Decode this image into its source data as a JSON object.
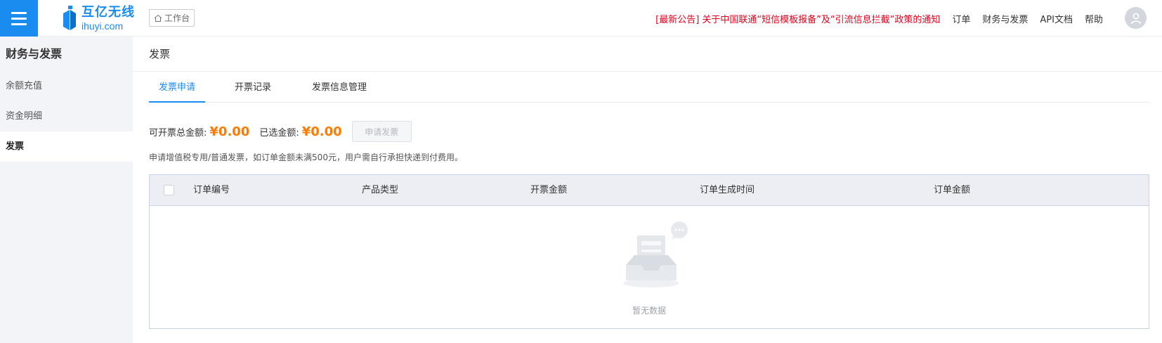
{
  "topbar": {
    "menu_icon": "hamburger-icon",
    "logo": {
      "name_cn": "互亿无线",
      "name_en": "ihuyi.com"
    },
    "workbench_label": "工作台",
    "notice": "[最新公告] 关于中国联通“短信模板报备”及“引流信息拦截”政策的通知",
    "nav": [
      "订单",
      "财务与发票",
      "API文档",
      "帮助"
    ],
    "avatar_icon": "user-avatar-icon"
  },
  "sidebar": {
    "title": "财务与发票",
    "items": [
      {
        "label": "余额充值",
        "active": false
      },
      {
        "label": "资金明细",
        "active": false
      },
      {
        "label": "发票",
        "active": true
      }
    ]
  },
  "main": {
    "page_title": "发票",
    "tabs": [
      {
        "label": "发票申请",
        "active": true
      },
      {
        "label": "开票记录",
        "active": false
      },
      {
        "label": "发票信息管理",
        "active": false
      }
    ],
    "invoiceable_label": "可开票总金额:",
    "invoiceable_amount": "¥0.00",
    "selected_label": "已选金额:",
    "selected_amount": "¥0.00",
    "apply_button": "申请发票",
    "note": "申请增值税专用/普通发票，如订单金额未满500元，用户需自行承担快递到付费用。",
    "table": {
      "columns": [
        "订单编号",
        "产品类型",
        "开票金额",
        "订单生成时间",
        "订单金额"
      ],
      "rows": [],
      "empty_text": "暂无数据"
    }
  },
  "colors": {
    "accent": "#1a8cf0",
    "amount": "#ff7a00",
    "notice": "#e0001c"
  }
}
